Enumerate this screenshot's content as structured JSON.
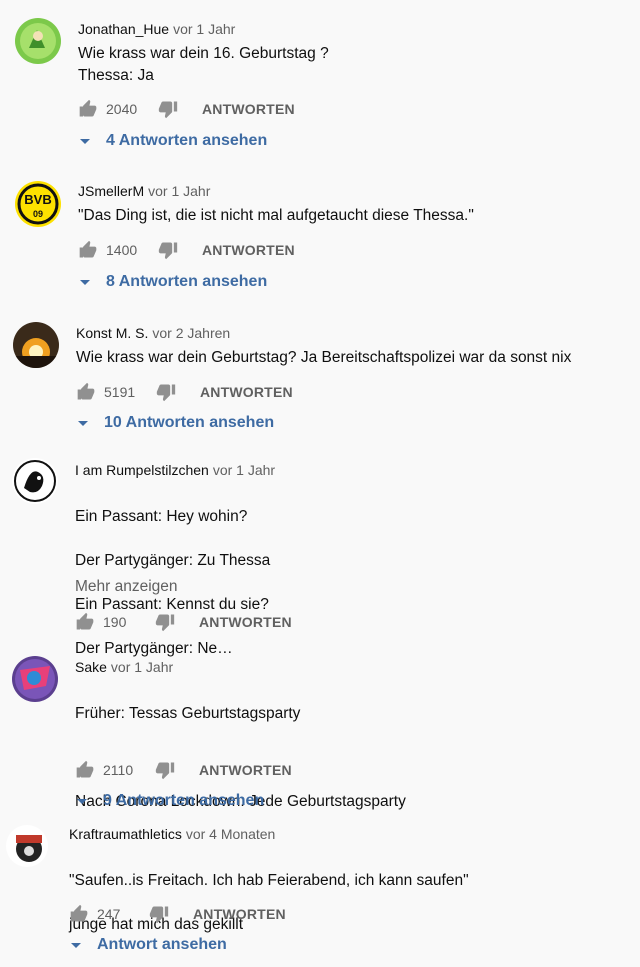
{
  "reply_label": "ANTWORTEN",
  "comments": [
    {
      "author": "Jonathan_Hue",
      "time": "vor 1 Jahr",
      "lines": [
        "Wie krass war dein 16. Geburtstag ?",
        "Thessa: Ja"
      ],
      "likes": "2040",
      "replies": "4 Antworten ansehen",
      "more": ""
    },
    {
      "author": "JSmellerM",
      "time": "vor 1 Jahr",
      "lines": [
        "\"Das Ding ist, die ist nicht mal aufgetaucht diese Thessa.\""
      ],
      "likes": "1400",
      "replies": "8 Antworten ansehen",
      "more": ""
    },
    {
      "author": "Konst M. S.",
      "time": "vor 2 Jahren",
      "lines": [
        "Wie krass war dein Geburtstag? Ja Bereitschaftspolizei war da sonst nix"
      ],
      "likes": "5191",
      "replies": "10 Antworten ansehen",
      "more": ""
    },
    {
      "author": "I am Rumpelstilzchen",
      "time": "vor 1 Jahr",
      "lines": [
        "Ein Passant: Hey wohin?",
        "Der Partygänger: Zu Thessa",
        "Ein Passant: Kennst du sie?",
        "Der Partygänger: Ne…"
      ],
      "likes": "190",
      "replies": "",
      "more": "Mehr anzeigen"
    },
    {
      "author": "Sake",
      "time": "vor 1 Jahr",
      "lines": [
        "Früher: Tessas Geburtstagsparty",
        "",
        "Nach Corona Lockdown: Jede Geburtstagsparty"
      ],
      "likes": "2110",
      "replies": "9 Antworten ansehen",
      "more": ""
    },
    {
      "author": "Kraftraumathletics",
      "time": "vor 4 Monaten",
      "lines": [
        "\"Saufen..is Freitach. Ich hab Feierabend, ich kann saufen\"",
        "junge hat mich das gekillt"
      ],
      "likes": "247",
      "replies": "Antwort ansehen",
      "more": ""
    }
  ]
}
